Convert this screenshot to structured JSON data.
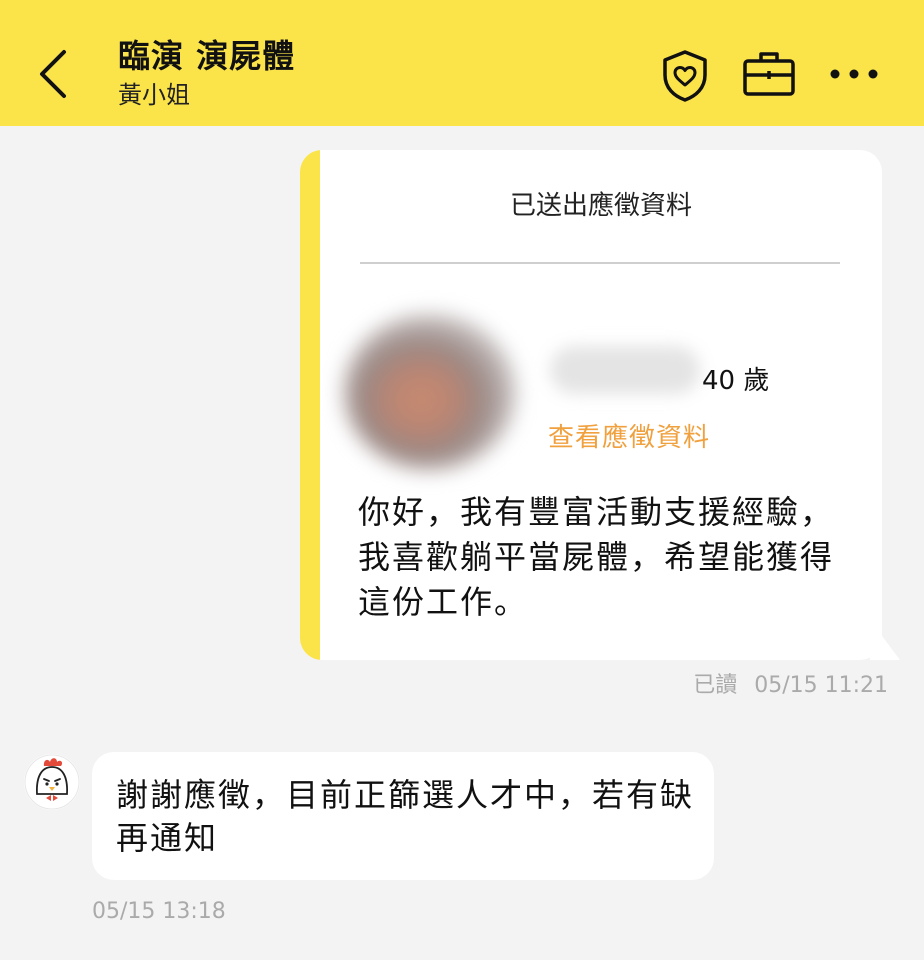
{
  "header": {
    "title": "臨演 演屍體",
    "subtitle": "黃小姐",
    "bg_color": "#fbe34a",
    "icons": [
      "back-chevron-icon",
      "shield-heart-icon",
      "briefcase-icon",
      "more-dots-icon"
    ]
  },
  "application_card": {
    "title": "已送出應徵資料",
    "age": "40 歲",
    "view_link": "查看應徵資料",
    "message": "你好，我有豐富活動支援經驗，我喜歡躺平當屍體，希望能獲得這份工作。",
    "read_status": "已讀",
    "timestamp": "05/15 11:21",
    "accent_color": "#fbe34a",
    "link_color": "#f0a03d"
  },
  "reply": {
    "text": "謝謝應徵，目前正篩選人才中，若有缺再通知",
    "timestamp": "05/15 13:18",
    "avatar_icon": "chicken-avatar-icon"
  }
}
